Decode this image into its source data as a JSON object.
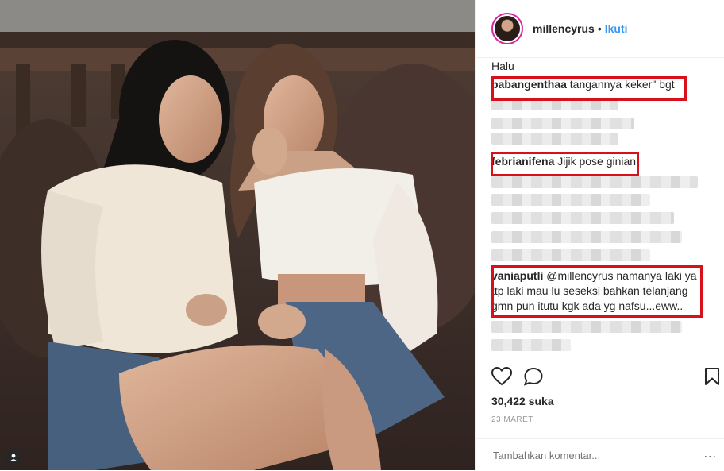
{
  "post": {
    "username": "millencyrus",
    "separator": "•",
    "follow_label": "Ikuti",
    "caption": "Halu"
  },
  "comments": [
    {
      "user": "babangenthaa",
      "text": "tangannya keker\" bgt"
    },
    {
      "user": "febrianifena",
      "text": "Jijik pose ginian"
    },
    {
      "user": "vaniaputli",
      "text_lines": [
        "@millencyrus namanya laki ya",
        "ttp laki mau lu seseksi bahkan telanjang",
        "gmn pun itutu kgk ada yg nafsu...eww.."
      ]
    }
  ],
  "actions": {
    "like_icon": "heart-icon",
    "comment_icon": "comment-bubble-icon",
    "save_icon": "bookmark-icon"
  },
  "likes": "30,422 suka",
  "date": "23 MARET",
  "add_comment": {
    "placeholder": "Tambahkan komentar..."
  },
  "more_label": "...",
  "colors": {
    "highlight": "#d8101a",
    "link": "#3897f0",
    "text": "#262626"
  }
}
